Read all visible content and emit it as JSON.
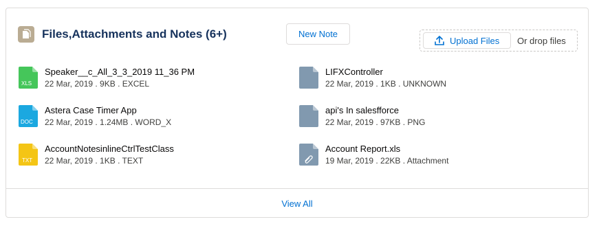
{
  "header": {
    "title": "Files,Attachments and Notes (6+)",
    "icon": "files-icon",
    "new_note_label": "New Note",
    "upload_label": "Upload Files",
    "drop_text": "Or drop files"
  },
  "files": [
    {
      "name": "Speaker__c_All_3_3_2019 11_36 PM",
      "meta": "22 Mar, 2019 . 9KB . EXCEL",
      "badge": "XLS",
      "color": "#45c65a"
    },
    {
      "name": "LIFXController",
      "meta": "22 Mar, 2019 . 1KB . UNKNOWN",
      "badge": "",
      "color": "#8199af"
    },
    {
      "name": "Astera Case Timer App",
      "meta": "22 Mar, 2019 . 1.24MB . WORD_X",
      "badge": "DOC",
      "color": "#1ba8e0"
    },
    {
      "name": "api's In salesfforce",
      "meta": "22 Mar, 2019 . 97KB . PNG",
      "badge": "",
      "color": "#8199af"
    },
    {
      "name": "AccountNotesinlineCtrlTestClass",
      "meta": "22 Mar, 2019 . 1KB . TEXT",
      "badge": "TXT",
      "color": "#f4c515"
    },
    {
      "name": "Account Report.xls",
      "meta": "19 Mar, 2019 . 22KB . Attachment",
      "badge": "",
      "color": "#8199af"
    }
  ],
  "footer": {
    "view_all_label": "View All"
  }
}
